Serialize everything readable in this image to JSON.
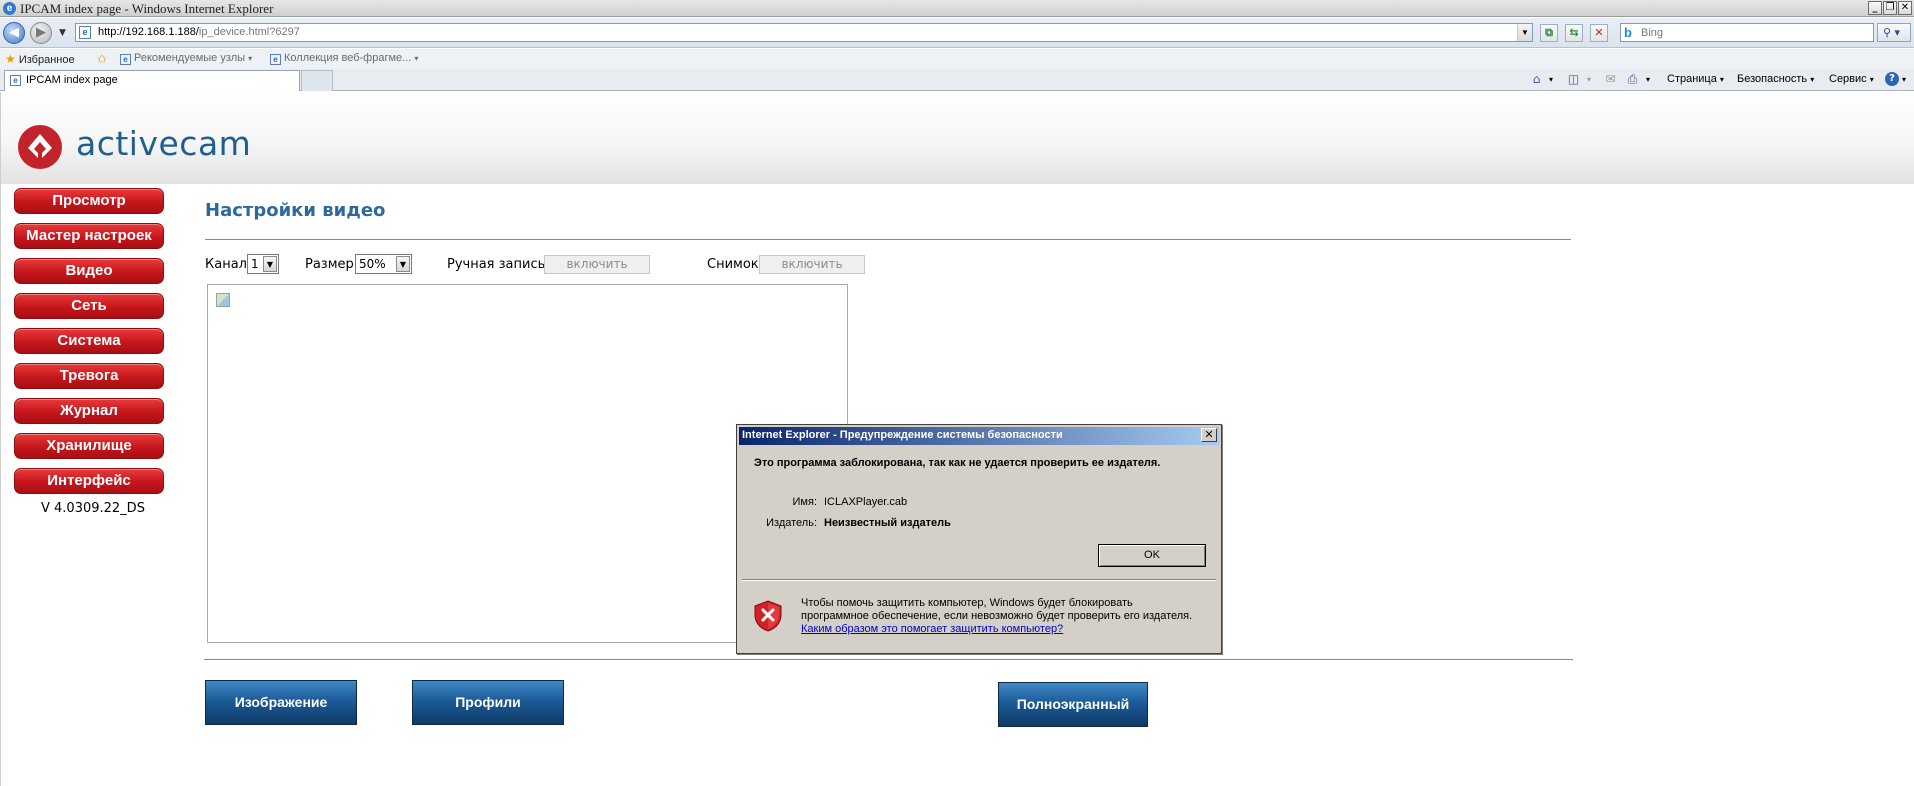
{
  "window": {
    "title": "IPCAM index page - Windows Internet Explorer",
    "ie_icon_glyph": "e",
    "minimize_glyph": "_",
    "restore_glyph": "❐",
    "close_glyph": "✕"
  },
  "address_bar": {
    "url_host": "http://192.168.1.188/",
    "url_path": "ip_device.html?6297",
    "search_placeholder": "Bing",
    "search_engine_glyph": "b",
    "back_glyph": "◀",
    "forward_glyph": "▶",
    "drop_glyph": "▼",
    "search_button_glyph": "⚲ ▾",
    "compat_glyph": "⧉",
    "refresh_glyph": "⇆",
    "stop_glyph": "✕"
  },
  "favorites_bar": {
    "favorites_label": "Избранное",
    "items": [
      "Рекомендуемые узлы",
      "Коллекция веб-фрагме..."
    ],
    "caret": "▾"
  },
  "tabs": {
    "active_tab_label": "IPCAM index page"
  },
  "command_bar": {
    "page_label": "Страница",
    "safety_label": "Безопасность",
    "tools_label": "Сервис",
    "help_glyph": "?",
    "home_glyph": "⌂",
    "feeds_glyph": "◫",
    "mail_glyph": "✉",
    "print_glyph": "⎙",
    "caret": "▾"
  },
  "brand": {
    "logo_text": "activecam"
  },
  "sidebar": {
    "items": [
      {
        "label": "Просмотр"
      },
      {
        "label": "Мастер настроек"
      },
      {
        "label": "Видео"
      },
      {
        "label": "Сеть"
      },
      {
        "label": "Система"
      },
      {
        "label": "Тревога"
      },
      {
        "label": "Журнал"
      },
      {
        "label": "Хранилище"
      },
      {
        "label": "Интерфейс"
      }
    ],
    "version": "V 4.0309.22_DS",
    "accent_color": "#c5161c"
  },
  "main": {
    "title": "Настройки видео",
    "channel_label": "Канал",
    "channel_value": "1",
    "size_label": "Размер",
    "size_value": "50%",
    "manual_record_label": "Ручная запись",
    "manual_record_button": "включить",
    "snapshot_label": "Снимок",
    "snapshot_button": "включить",
    "select_arrow": "▼",
    "bottom_buttons": {
      "image": "Изображение",
      "profiles": "Профили",
      "fullscreen": "Полноэкранный"
    },
    "title_color": "#2d6a9b",
    "button_color": "#1c5b97"
  },
  "dialog": {
    "title": "Internet Explorer - Предупреждение системы безопасности",
    "close_glyph": "✕",
    "heading": "Это программа заблокирована, так как не удается проверить ее издателя.",
    "name_label": "Имя:",
    "name_value": "ICLAXPlayer.cab",
    "publisher_label": "Издатель:",
    "publisher_value": "Неизвестный издатель",
    "ok_label": "OK",
    "note_line1": "Чтобы помочь защитить компьютер, Windows будет блокировать",
    "note_line2": "программное обеспечение, если невозможно будет проверить его издателя.",
    "link_text": "Каким образом это помогает защитить компьютер?"
  }
}
